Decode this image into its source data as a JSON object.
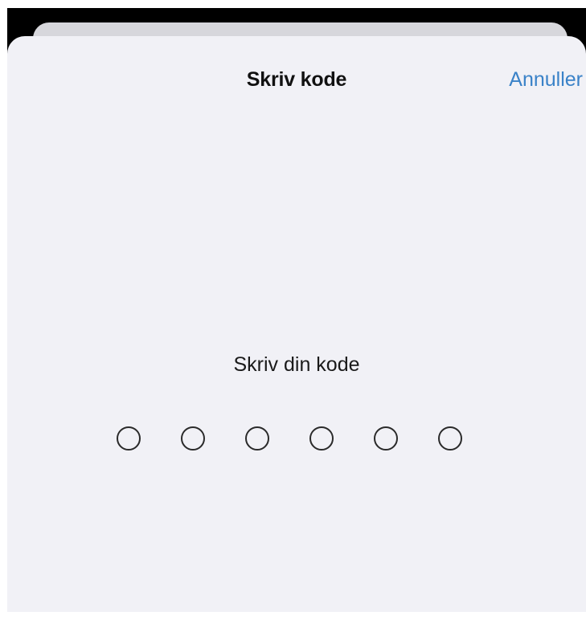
{
  "header": {
    "title": "Skriv kode",
    "cancel_label": "Annuller"
  },
  "passcode": {
    "prompt": "Skriv din kode",
    "length": 6,
    "entered": 0
  },
  "colors": {
    "accent": "#3a82c8",
    "sheet_background": "#f1f1f6",
    "backdrop": "#000000"
  }
}
